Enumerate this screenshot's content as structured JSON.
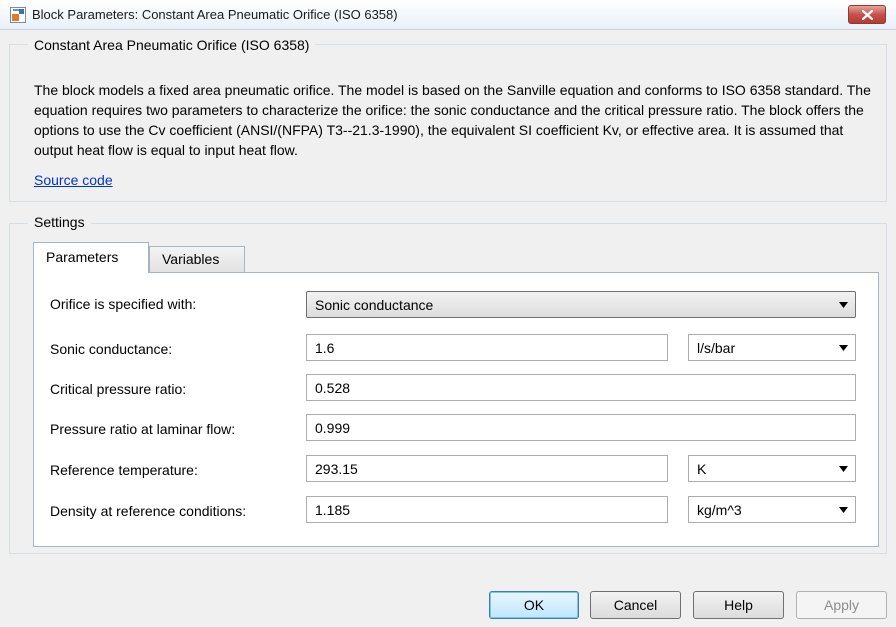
{
  "window": {
    "title": "Block Parameters: Constant Area Pneumatic Orifice (ISO 6358)",
    "close_icon": "close-icon"
  },
  "block": {
    "name": "Constant Area Pneumatic Orifice (ISO 6358)",
    "description": "The block models a fixed area pneumatic orifice. The model is based on the Sanville equation and conforms to ISO 6358 standard. The equation requires two parameters to characterize the orifice: the sonic conductance and the critical pressure ratio. The block offers the options to use the Cv coefficient (ANSI/(NFPA) T3--21.3-1990), the equivalent SI coefficient Kv, or effective area. It is assumed that output heat flow is equal to input heat flow.",
    "source_link": "Source code"
  },
  "settings": {
    "label": "Settings",
    "tabs": [
      {
        "label": "Parameters",
        "active": true
      },
      {
        "label": "Variables",
        "active": false
      }
    ],
    "params": {
      "orifice_spec": {
        "label": "Orifice is specified with:",
        "value": "Sonic conductance"
      },
      "sonic_conductance": {
        "label": "Sonic conductance:",
        "value": "1.6",
        "unit": "l/s/bar"
      },
      "critical_ratio": {
        "label": "Critical pressure ratio:",
        "value": "0.528"
      },
      "laminar_ratio": {
        "label": "Pressure ratio at laminar flow:",
        "value": "0.999"
      },
      "ref_temperature": {
        "label": "Reference temperature:",
        "value": "293.15",
        "unit": "K"
      },
      "ref_density": {
        "label": "Density at reference conditions:",
        "value": "1.185",
        "unit": "kg/m^3"
      }
    }
  },
  "buttons": {
    "ok": "OK",
    "cancel": "Cancel",
    "help": "Help",
    "apply": "Apply"
  },
  "colors": {
    "link": "#0033cc",
    "close_button": "#c75050",
    "disabled_text": "#8d8d8d"
  }
}
